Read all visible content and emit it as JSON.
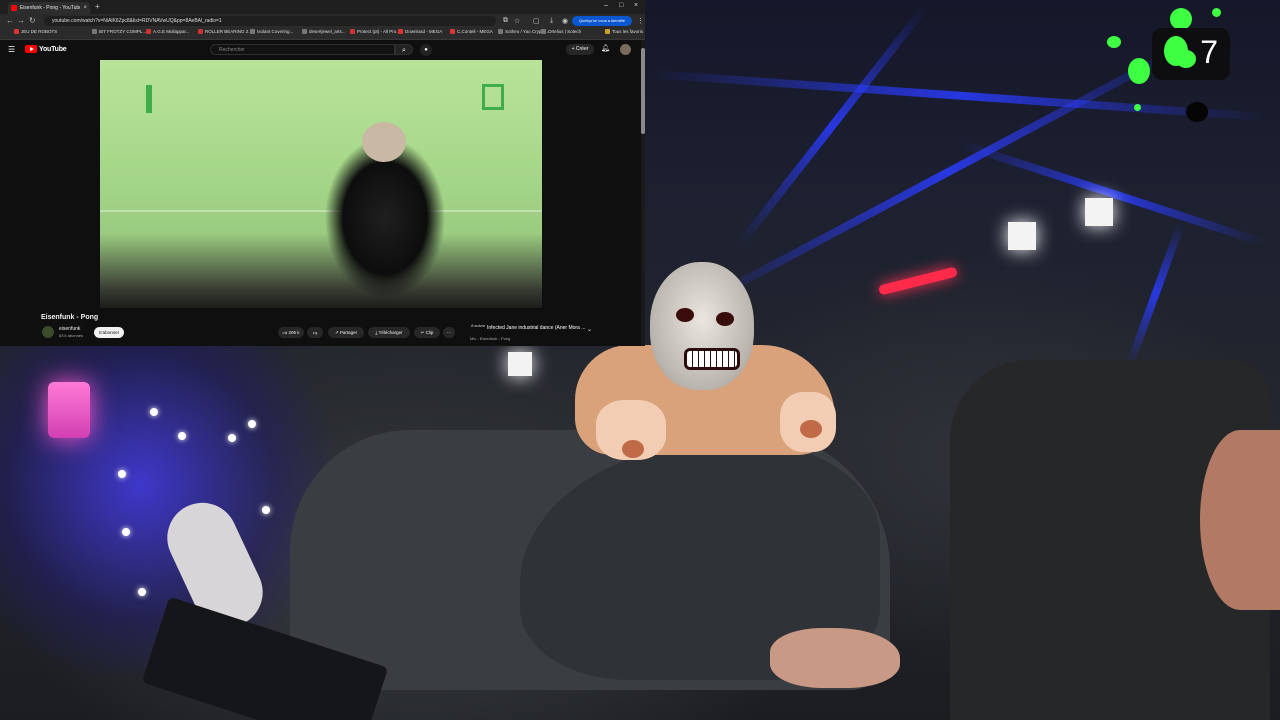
{
  "browser": {
    "tab_title": "Eisenfunk - Pong - YouTube",
    "tab_close": "×",
    "new_tab": "+",
    "window_controls": {
      "minimize": "–",
      "maximize": "□",
      "close": "×"
    },
    "url": "youtube.com/watch?v=NiAlK6Zpc8&list=RDVNAVwUQ&pp=8AeBAl_radio=1",
    "notification": "Quelqu'un vous a identifié",
    "bookmarks": [
      "JEU DE ROBOTS",
      "BIT FROTZY COMPL...",
      "A.G.E Muliappar...",
      "ROLLER BEARING 2...",
      "Isolant Covering...",
      "desertjewel_arts...",
      "Protect (pt) - All Pro...",
      "Download - MEGA",
      "C.Conteli - MEGA",
      "Sotheo / Yao Crypto...",
      "Ortelius | Sotech",
      "Tous les favoris"
    ]
  },
  "youtube": {
    "logo_text": "YouTube",
    "search_placeholder": "Rechercher",
    "create_label": "+ Créer",
    "video_title": "Eisenfunk - Pong",
    "channel_name": "eisenfunk",
    "channel_subs": "83 k abonnés",
    "subscribe_label": "S'abonner",
    "like_count": "206 k",
    "share_label": "Partager",
    "download_label": "Télécharger",
    "clip_label": "Clip",
    "more_label": "···",
    "up_next": {
      "prefix": "A suivre",
      "title": "Infected Jane industrial dance (Aner Mora ...",
      "subtitle": "Mix - Eisenfunk - Pong"
    }
  },
  "overlay": {
    "counter": "7"
  },
  "colors": {
    "yt_red": "#ff0000",
    "splat_green": "#3fff43",
    "neon_blue": "#2a3cff",
    "neon_red": "#ff2a4a"
  }
}
